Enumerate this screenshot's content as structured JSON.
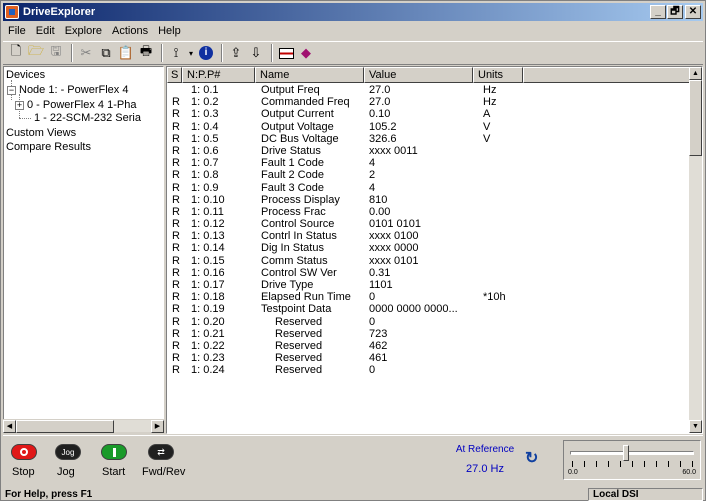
{
  "window": {
    "title": "DriveExplorer",
    "min_label": "_",
    "max_label": "🗗",
    "close_label": "✕"
  },
  "menu": [
    "File",
    "Edit",
    "Explore",
    "Actions",
    "Help"
  ],
  "toolbar": {
    "icons": [
      "new-icon",
      "open-icon",
      "save-icon",
      "cut-icon",
      "copy-icon",
      "paste-icon",
      "print-icon",
      "connect-icon",
      "info-icon",
      "upload-icon",
      "download-icon",
      "monitor-icon",
      "help-book-icon"
    ]
  },
  "tree": {
    "devices": "Devices",
    "node1": "Node 1: - PowerFlex 4",
    "node1_0": "0 - PowerFlex 4 1-Pha",
    "node1_1": "1 - 22-SCM-232 Seria",
    "custom_views": "Custom Views",
    "compare_results": "Compare Results",
    "expand_minus": "−",
    "expand_plus": "+"
  },
  "table": {
    "headers": {
      "s": "S",
      "param": "N:P.P#",
      "name": "Name",
      "value": "Value",
      "units": "Units"
    },
    "rows": [
      {
        "s": "",
        "param": "1: 0.1",
        "name": "Output Freq",
        "value": "27.0",
        "units": "Hz"
      },
      {
        "s": "R",
        "param": "1: 0.2",
        "name": "Commanded Freq",
        "value": "27.0",
        "units": "Hz"
      },
      {
        "s": "R",
        "param": "1: 0.3",
        "name": "Output Current",
        "value": "0.10",
        "units": "A"
      },
      {
        "s": "R",
        "param": "1: 0.4",
        "name": "Output Voltage",
        "value": "105.2",
        "units": "V"
      },
      {
        "s": "R",
        "param": "1: 0.5",
        "name": "DC Bus Voltage",
        "value": "326.6",
        "units": "V"
      },
      {
        "s": "R",
        "param": "1: 0.6",
        "name": "Drive Status",
        "value": "xxxx 0011",
        "units": ""
      },
      {
        "s": "R",
        "param": "1: 0.7",
        "name": "Fault 1 Code",
        "value": "4",
        "units": ""
      },
      {
        "s": "R",
        "param": "1: 0.8",
        "name": "Fault 2 Code",
        "value": "2",
        "units": ""
      },
      {
        "s": "R",
        "param": "1: 0.9",
        "name": "Fault 3 Code",
        "value": "4",
        "units": ""
      },
      {
        "s": "R",
        "param": "1: 0.10",
        "name": "Process Display",
        "value": "810",
        "units": ""
      },
      {
        "s": "R",
        "param": "1: 0.11",
        "name": "Process Frac",
        "value": "0.00",
        "units": ""
      },
      {
        "s": "R",
        "param": "1: 0.12",
        "name": "Control Source",
        "value": "0101 0101",
        "units": ""
      },
      {
        "s": "R",
        "param": "1: 0.13",
        "name": "Contrl In Status",
        "value": "xxxx 0100",
        "units": ""
      },
      {
        "s": "R",
        "param": "1: 0.14",
        "name": "Dig In Status",
        "value": "xxxx 0000",
        "units": ""
      },
      {
        "s": "R",
        "param": "1: 0.15",
        "name": "Comm Status",
        "value": "xxxx 0101",
        "units": ""
      },
      {
        "s": "R",
        "param": "1: 0.16",
        "name": "Control SW Ver",
        "value": "0.31",
        "units": ""
      },
      {
        "s": "R",
        "param": "1: 0.17",
        "name": "Drive Type",
        "value": "1101",
        "units": ""
      },
      {
        "s": "R",
        "param": "1: 0.18",
        "name": "Elapsed Run Time",
        "value": "0",
        "units": "*10h"
      },
      {
        "s": "R",
        "param": "1: 0.19",
        "name": "Testpoint Data",
        "value": "0000 0000 0000...",
        "units": ""
      },
      {
        "s": "R",
        "param": "1: 0.20",
        "name": "Reserved",
        "value": "0",
        "units": ""
      },
      {
        "s": "R",
        "param": "1: 0.21",
        "name": "Reserved",
        "value": "723",
        "units": ""
      },
      {
        "s": "R",
        "param": "1: 0.22",
        "name": "Reserved",
        "value": "462",
        "units": ""
      },
      {
        "s": "R",
        "param": "1: 0.23",
        "name": "Reserved",
        "value": "461",
        "units": ""
      },
      {
        "s": "R",
        "param": "1: 0.24",
        "name": "Reserved",
        "value": "0",
        "units": ""
      }
    ]
  },
  "controls": {
    "stop": "Stop",
    "jog": "Jog",
    "start": "Start",
    "fwdrev": "Fwd/Rev",
    "jog_btn": "Jog"
  },
  "reference": {
    "status": "At Reference",
    "freq": "27.0 Hz"
  },
  "speed_slider": {
    "min_label": "0.0",
    "max_label": "60.0",
    "value": 27.0
  },
  "statusbar": {
    "help": "For Help, press F1",
    "mode": "Local DSI"
  },
  "colors": {
    "stop_button": "#e01818",
    "jog_button": "#202020",
    "start_button": "#1a9a2a",
    "fwdrev_button": "#202020",
    "reference_text": "#0000c0"
  }
}
